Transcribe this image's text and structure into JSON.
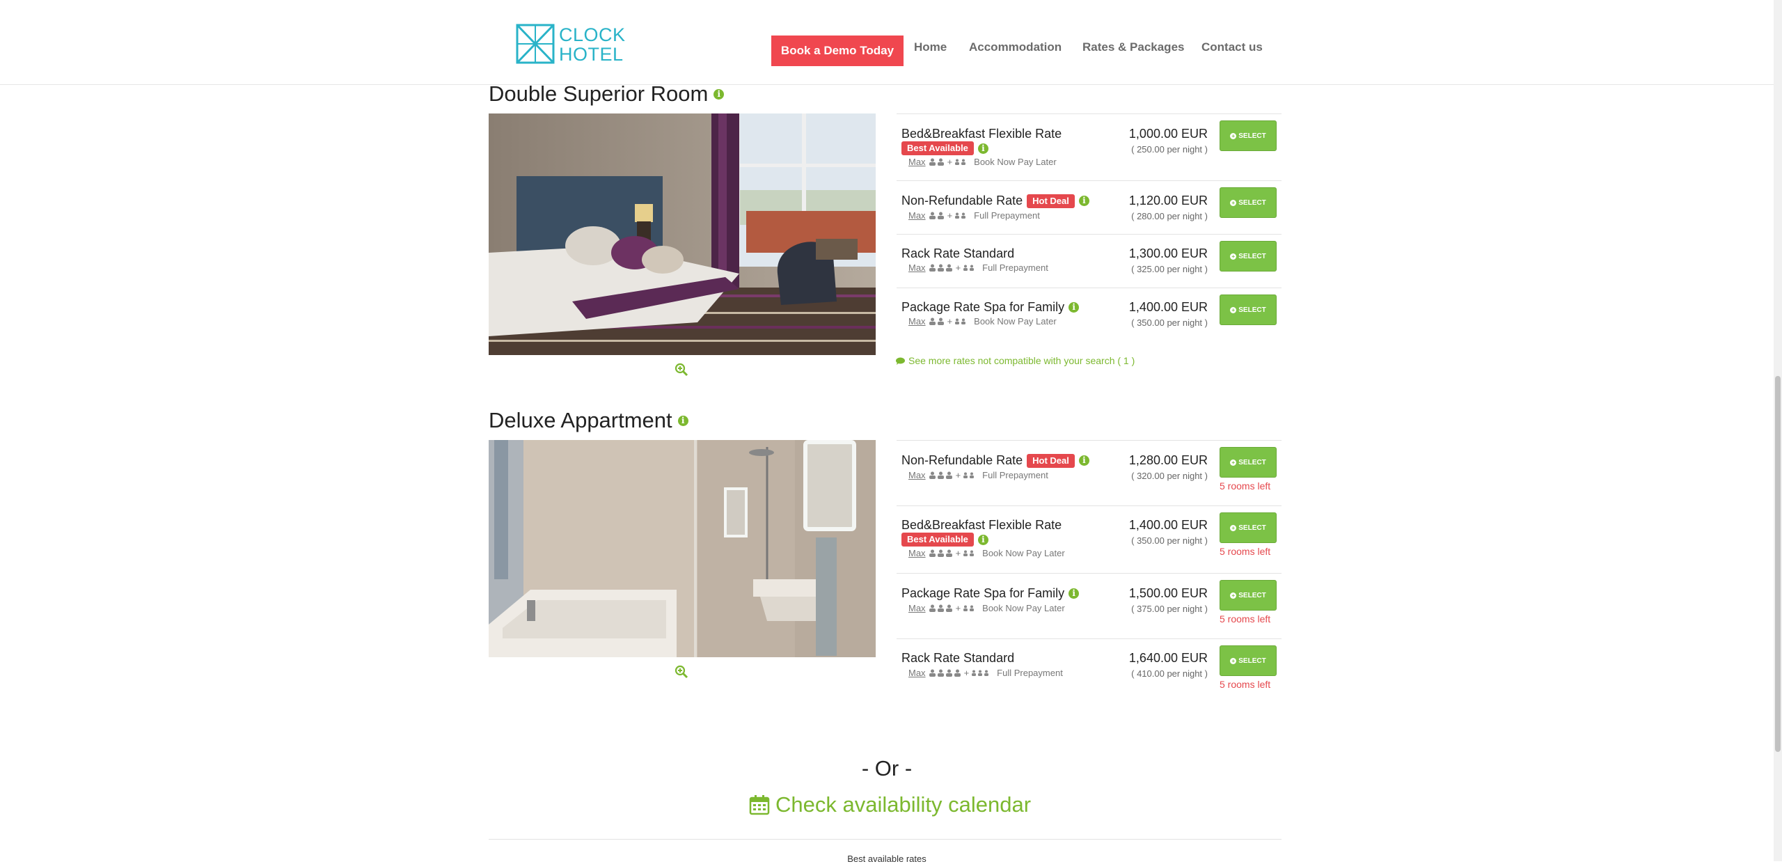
{
  "header": {
    "logo_line1": "CLOCK",
    "logo_line2": "HOTEL",
    "demo_button": "Book a Demo Today",
    "nav": [
      "Home",
      "Accommodation",
      "Rates & Packages",
      "Contact us"
    ]
  },
  "colors": {
    "accent_green": "#7cc246",
    "badge_red": "#e5484d",
    "demo_red": "#f0474f",
    "logo_teal": "#29b3c8"
  },
  "rooms": [
    {
      "title": "Double Superior Room",
      "rates": [
        {
          "name": "Bed&Breakfast Flexible Rate",
          "badge": "Best Available",
          "max": "Max",
          "policy": "Book Now Pay Later",
          "price": "1,000.00 EUR",
          "per_night": "( 250.00 per night )",
          "select": "SELECT"
        },
        {
          "name": "Non-Refundable Rate",
          "badge": "Hot Deal",
          "max": "Max",
          "policy": "Full Prepayment",
          "price": "1,120.00 EUR",
          "per_night": "( 280.00 per night )",
          "select": "SELECT"
        },
        {
          "name": "Rack Rate Standard",
          "max": "Max",
          "policy": "Full Prepayment",
          "price": "1,300.00 EUR",
          "per_night": "( 325.00 per night )",
          "select": "SELECT"
        },
        {
          "name": "Package Rate Spa for Family",
          "max": "Max",
          "policy": "Book Now Pay Later",
          "price": "1,400.00 EUR",
          "per_night": "( 350.00 per night )",
          "select": "SELECT"
        }
      ],
      "more_rates": "See more rates not compatible with your search ( 1 )"
    },
    {
      "title": "Deluxe Appartment",
      "rates": [
        {
          "name": "Non-Refundable Rate",
          "badge": "Hot Deal",
          "max": "Max",
          "policy": "Full Prepayment",
          "price": "1,280.00 EUR",
          "per_night": "( 320.00 per night )",
          "select": "SELECT",
          "rooms_left": "5 rooms left"
        },
        {
          "name": "Bed&Breakfast Flexible Rate",
          "badge": "Best Available",
          "max": "Max",
          "policy": "Book Now Pay Later",
          "price": "1,400.00 EUR",
          "per_night": "( 350.00 per night )",
          "select": "SELECT",
          "rooms_left": "5 rooms left"
        },
        {
          "name": "Package Rate Spa for Family",
          "max": "Max",
          "policy": "Book Now Pay Later",
          "price": "1,500.00 EUR",
          "per_night": "( 375.00 per night )",
          "select": "SELECT",
          "rooms_left": "5 rooms left"
        },
        {
          "name": "Rack Rate Standard",
          "max": "Max",
          "policy": "Full Prepayment",
          "price": "1,640.00 EUR",
          "per_night": "( 410.00 per night )",
          "select": "SELECT",
          "rooms_left": "5 rooms left"
        }
      ]
    }
  ],
  "or_text": "- Or -",
  "calendar_link": "Check availability calendar",
  "bottom_text": "Best available rates"
}
